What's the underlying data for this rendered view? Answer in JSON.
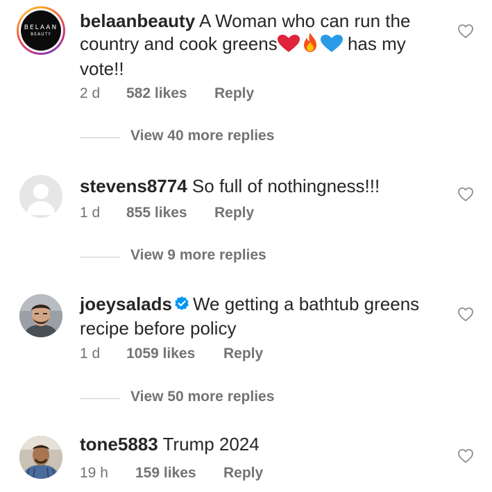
{
  "comments": [
    {
      "username": "belaanbeauty",
      "text_part1": "A Woman who can run the country and cook greens",
      "emojis": [
        "red-heart",
        "fire",
        "blue-heart"
      ],
      "text_part2": " has my vote!!",
      "avatar": {
        "type": "logo",
        "logo_line1": "BELAAN",
        "logo_line2": "BEAUTY",
        "story_ring": true
      },
      "time": "2 d",
      "likes": "582 likes",
      "reply": "Reply",
      "view_replies": "View 40 more replies"
    },
    {
      "username": "stevens8774",
      "text": "So full of nothingness!!!",
      "avatar": {
        "type": "default-silhouette"
      },
      "time": "1 d",
      "likes": "855 likes",
      "reply": "Reply",
      "view_replies": "View 9 more replies"
    },
    {
      "username": "joeysalads",
      "verified": true,
      "text": "We getting a bathtub greens recipe before policy",
      "avatar": {
        "type": "photo"
      },
      "time": "1 d",
      "likes": "1059 likes",
      "reply": "Reply",
      "view_replies": "View 50 more replies"
    },
    {
      "username": "tone5883",
      "text": "Trump 2024",
      "avatar": {
        "type": "photo"
      },
      "time": "19 h",
      "likes": "159 likes",
      "reply": "Reply"
    }
  ],
  "icons": {
    "like": "heart-outline-icon",
    "verified": "verified-badge-icon"
  },
  "colors": {
    "text": "#262626",
    "secondary": "#737373",
    "verified": "#0095f6",
    "divider": "#c7c7c7"
  }
}
